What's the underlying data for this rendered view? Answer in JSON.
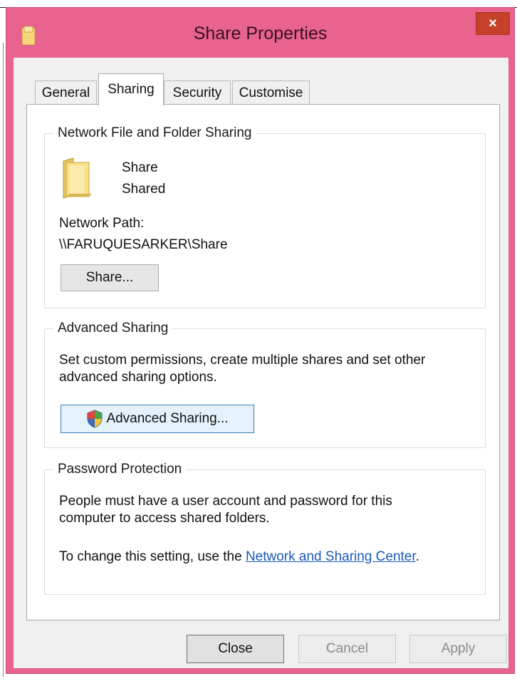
{
  "window": {
    "title": "Share Properties",
    "close_label": "×"
  },
  "tabs": [
    {
      "label": "General"
    },
    {
      "label": "Sharing"
    },
    {
      "label": "Security"
    },
    {
      "label": "Customise"
    }
  ],
  "network_sharing": {
    "legend": "Network File and Folder Sharing",
    "folder_name": "Share",
    "folder_status": "Shared",
    "path_label": "Network Path:",
    "path_value": "\\\\FARUQUESARKER\\Share",
    "share_button": "Share..."
  },
  "advanced_sharing": {
    "legend": "Advanced Sharing",
    "description_line1": "Set custom permissions, create multiple shares and set other",
    "description_line2": "advanced sharing options.",
    "button": "Advanced Sharing..."
  },
  "password_protection": {
    "legend": "Password Protection",
    "description_line1": "People must have a user account and password for this",
    "description_line2": "computer to access shared folders.",
    "change_text": "To change this setting, use the ",
    "link_text": "Network and Sharing Center",
    "period": "."
  },
  "footer": {
    "close": "Close",
    "cancel": "Cancel",
    "apply": "Apply"
  },
  "colors": {
    "frame": "#e8648f",
    "close_button": "#c7402a",
    "link": "#1a58b8"
  }
}
